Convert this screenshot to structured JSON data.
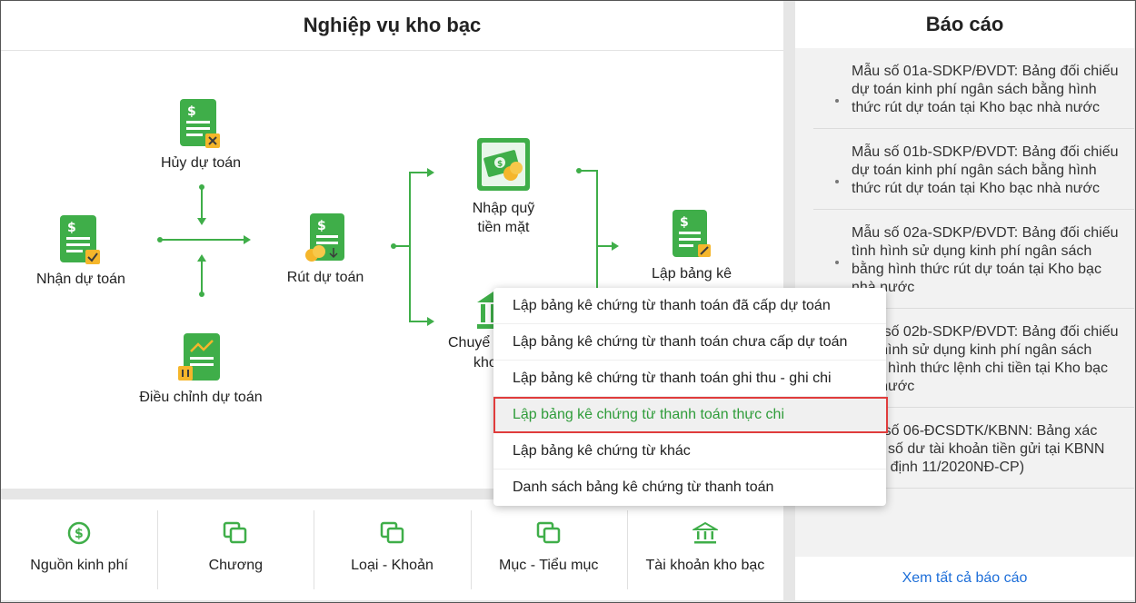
{
  "main": {
    "title": "Nghiệp vụ kho bạc",
    "nodes": {
      "nhan_du_toan": "Nhận dự toán",
      "huy_du_toan": "Hủy dự toán",
      "dieu_chinh_du_toan": "Điều chỉnh dự toán",
      "rut_du_toan": "Rút dự toán",
      "nhap_quy": "Nhập quỹ",
      "tien_mat": "tiền mặt",
      "chuyen_khoan_1": "Chuyể",
      "chuyen_khoan_2": "kho",
      "lap_bang_ke": "Lập bảng kê"
    }
  },
  "menu": {
    "items": [
      "Lập bảng kê chứng từ thanh toán đã cấp dự toán",
      "Lập bảng kê chứng từ thanh toán chưa cấp dự toán",
      "Lập bảng kê chứng từ thanh toán ghi thu - ghi chi",
      "Lập bảng kê chứng từ thanh toán thực chi",
      "Lập bảng kê chứng từ khác",
      "Danh sách bảng kê chứng từ thanh toán"
    ]
  },
  "bottom": {
    "items": [
      "Nguồn kinh phí",
      "Chương",
      "Loại - Khoản",
      "Mục - Tiểu mục",
      "Tài khoản kho bạc"
    ]
  },
  "reports": {
    "title": "Báo cáo",
    "items": [
      "Mẫu số 01a-SDKP/ĐVDT: Bảng đối chiếu dự toán kinh phí ngân sách bằng hình thức rút dự toán tại Kho bạc nhà nước",
      "Mẫu số 01b-SDKP/ĐVDT: Bảng đối chiếu dự toán kinh phí ngân sách bằng hình thức rút dự toán tại Kho bạc nhà nước",
      "Mẫu số 02a-SDKP/ĐVDT: Bảng đối chiếu tình hình sử dụng kinh phí ngân sách bằng hình thức rút dự toán tại Kho bạc nhà nước",
      "Mẫu số 02b-SDKP/ĐVDT: Bảng đối chiếu tình hình sử dụng kinh phí ngân sách bằng hình thức lệnh chi tiền tại Kho bạc nhà nước",
      "Mẫu số 06-ĐCSDTK/KBNN: Bảng xác nhận số dư tài khoản tiền gửi tại KBNN (Nghị định 11/2020NĐ-CP)"
    ],
    "view_all": "Xem tất cả báo cáo"
  },
  "colors": {
    "accent": "#3fae49",
    "highlight_border": "#e03c3c",
    "link": "#1e6fd9"
  }
}
